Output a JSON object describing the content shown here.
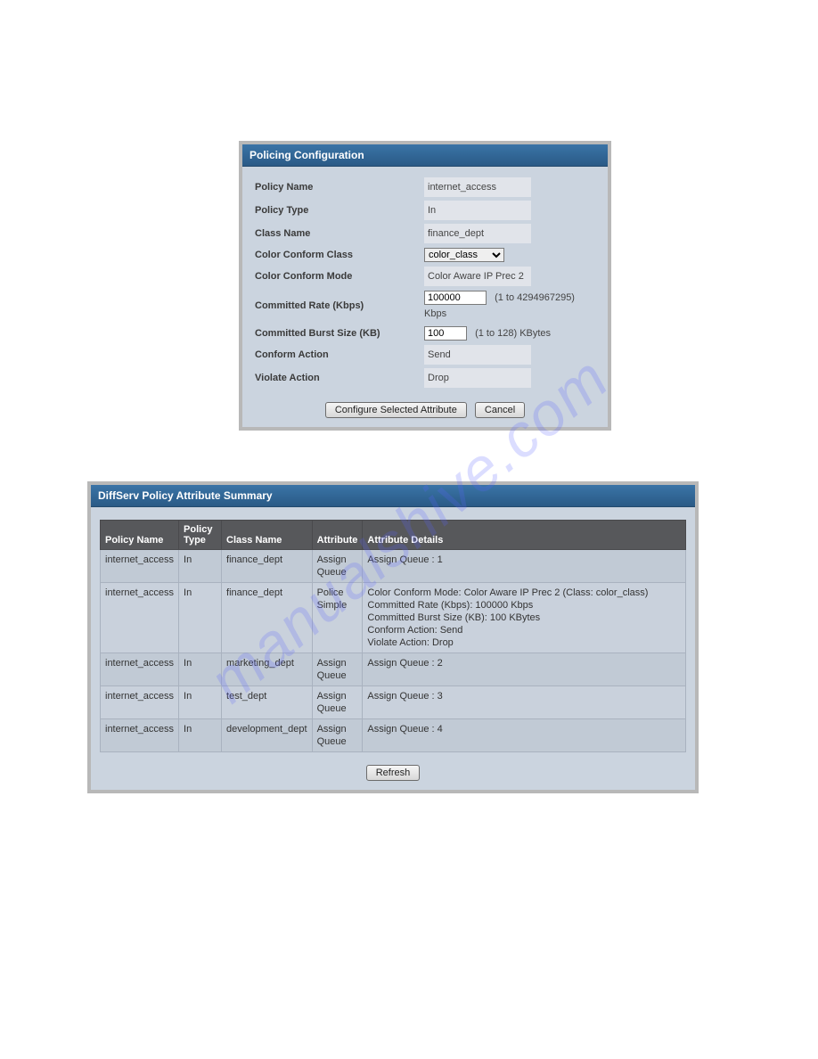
{
  "watermark": "manualshive.com",
  "panel1": {
    "title": "Policing Configuration",
    "rows": {
      "policy_name_label": "Policy Name",
      "policy_name_value": "internet_access",
      "policy_type_label": "Policy Type",
      "policy_type_value": "In",
      "class_name_label": "Class Name",
      "class_name_value": "finance_dept",
      "color_class_label": "Color Conform Class",
      "color_class_value": "color_class",
      "color_mode_label": "Color Conform Mode",
      "color_mode_value": "Color Aware IP Prec 2",
      "committed_rate_label": "Committed Rate (Kbps)",
      "committed_rate_value": "100000",
      "committed_rate_hint": "(1 to 4294967295) Kbps",
      "committed_burst_label": "Committed Burst Size (KB)",
      "committed_burst_value": "100",
      "committed_burst_hint": "(1 to 128) KBytes",
      "conform_action_label": "Conform Action",
      "conform_action_value": "Send",
      "violate_action_label": "Violate Action",
      "violate_action_value": "Drop"
    },
    "buttons": {
      "configure": "Configure Selected Attribute",
      "cancel": "Cancel"
    }
  },
  "panel2": {
    "title": "DiffServ Policy Attribute Summary",
    "headers": {
      "policy_name": "Policy Name",
      "policy_type": "Policy Type",
      "class_name": "Class Name",
      "attribute": "Attribute",
      "attribute_details": "Attribute Details"
    },
    "rows": [
      {
        "policy_name": "internet_access",
        "policy_type": "In",
        "class_name": "finance_dept",
        "attribute": "Assign Queue",
        "details": "Assign Queue :   1"
      },
      {
        "policy_name": "internet_access",
        "policy_type": "In",
        "class_name": "finance_dept",
        "attribute": "Police Simple",
        "details": "Color Conform Mode:   Color Aware IP Prec 2  (Class:   color_class)\nCommitted Rate (Kbps):   100000 Kbps\nCommitted Burst Size (KB):   100 KBytes\nConform Action:   Send\nViolate Action:   Drop"
      },
      {
        "policy_name": "internet_access",
        "policy_type": "In",
        "class_name": "marketing_dept",
        "attribute": "Assign Queue",
        "details": "Assign Queue :   2"
      },
      {
        "policy_name": "internet_access",
        "policy_type": "In",
        "class_name": "test_dept",
        "attribute": "Assign Queue",
        "details": "Assign Queue :   3"
      },
      {
        "policy_name": "internet_access",
        "policy_type": "In",
        "class_name": "development_dept",
        "attribute": "Assign Queue",
        "details": "Assign Queue :   4"
      }
    ],
    "buttons": {
      "refresh": "Refresh"
    }
  }
}
